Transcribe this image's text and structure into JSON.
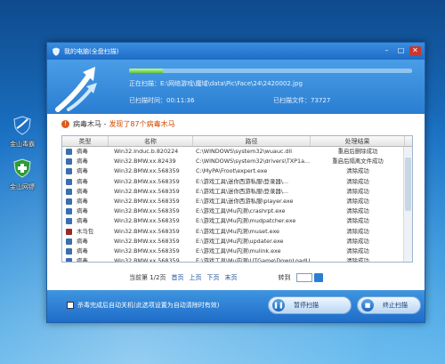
{
  "desktop": {
    "icons": [
      {
        "label": "金山毒霸",
        "icon": "shield-swoosh-icon"
      },
      {
        "label": "金山网镖",
        "icon": "shield-green-icon"
      }
    ]
  },
  "window": {
    "title": "我的电脑(全盘扫描)",
    "controls": {
      "minimize": "–",
      "maximize": "□",
      "close": "✕"
    }
  },
  "scan": {
    "progress_percent": 12,
    "current_label": "正在扫描：E:\\网络游戏\\魔域\\data\\Pic\\Face\\24\\2420002.jpg",
    "elapsed_label": "已扫描时间：00:11:36",
    "files_label": "已扫描文件：73727"
  },
  "section": {
    "title": "病毒木马 -",
    "found_text": "发现了87个病毒木马"
  },
  "table": {
    "headers": [
      "类型",
      "名称",
      "路径",
      "处理结果"
    ],
    "rows": [
      {
        "type": "病毒",
        "icon": "virus-icon",
        "name": "Win32.Induc.b.820224",
        "path": "C:\\WINDOWS\\system32\\wuauc.dll",
        "result": "重启后删除成功"
      },
      {
        "type": "病毒",
        "icon": "virus-icon",
        "name": "Win32.BMW.xx.82439",
        "path": "C:\\WINDOWS\\system32\\drivers\\TXP1a...",
        "result": "重启后隔离文件成功"
      },
      {
        "type": "病毒",
        "icon": "virus-icon",
        "name": "Win32.BMW.xx.568359",
        "path": "C:\\MyPA\\Froot\\expert.exe",
        "result": "清除成功"
      },
      {
        "type": "病毒",
        "icon": "virus-icon",
        "name": "Win32.BMW.xx.568359",
        "path": "E:\\游戏工具\\迷你西游私服\\登录器\\...",
        "result": "清除成功"
      },
      {
        "type": "病毒",
        "icon": "virus-icon",
        "name": "Win32.BMW.xx.568359",
        "path": "E:\\游戏工具\\迷你西游私服\\登录器\\...",
        "result": "清除成功"
      },
      {
        "type": "病毒",
        "icon": "virus-icon",
        "name": "Win32.BMW.xx.568359",
        "path": "E:\\游戏工具\\迷你西游私服\\player.exe",
        "result": "清除成功"
      },
      {
        "type": "病毒",
        "icon": "virus-icon",
        "name": "Win32.BMW.xx.568359",
        "path": "E:\\游戏工具\\Mu内测\\crashrpt.exe",
        "result": "清除成功"
      },
      {
        "type": "病毒",
        "icon": "virus-icon",
        "name": "Win32.BMW.xx.568359",
        "path": "E:\\游戏工具\\Mu内测\\mudpatcher.exe",
        "result": "清除成功"
      },
      {
        "type": "木马包",
        "icon": "trojan-icon",
        "name": "Win32.BMW.xx.568359",
        "path": "E:\\游戏工具\\Mu内测\\muset.exe",
        "result": "清除成功"
      },
      {
        "type": "病毒",
        "icon": "virus-icon",
        "name": "Win32.BMW.xx.568359",
        "path": "E:\\游戏工具\\Mu内测\\updater.exe",
        "result": "清除成功"
      },
      {
        "type": "病毒",
        "icon": "virus-icon",
        "name": "Win32.BMW.xx.568359",
        "path": "E:\\游戏工具\\Mu内测\\mulink.exe",
        "result": "清除成功"
      },
      {
        "type": "病毒",
        "icon": "virus-icon",
        "name": "Win32.BMW.xx.568359",
        "path": "E:\\游戏工具\\Mu内测\\UTGame\\DownLoadU...",
        "result": "清除成功"
      }
    ]
  },
  "pager": {
    "page_info": "当前第 1/2页",
    "first": "首页",
    "prev": "上页",
    "next": "下页",
    "last": "末页",
    "goto_label": "转到"
  },
  "footer": {
    "checkbox_label": "杀毒完成后自动关机(此选项设置为自动清除时有效)",
    "pause_label": "暂停扫描",
    "stop_label": "终止扫描"
  }
}
